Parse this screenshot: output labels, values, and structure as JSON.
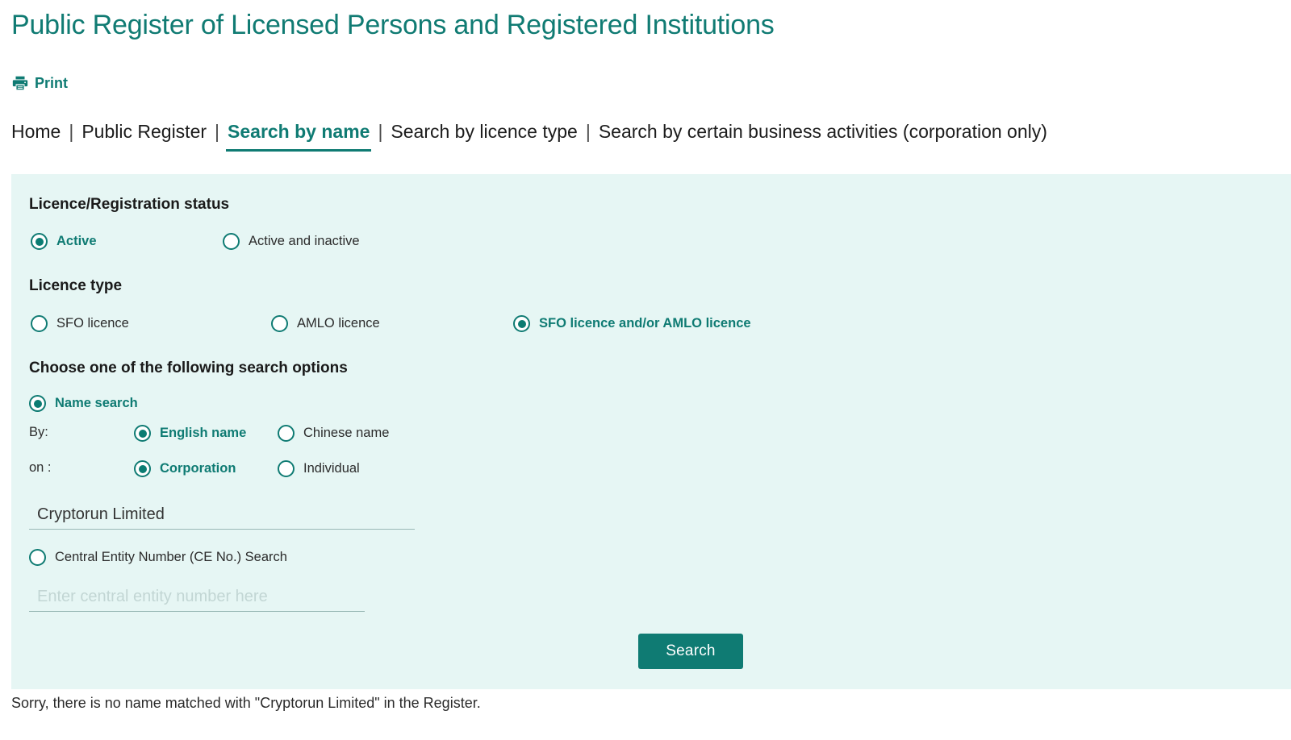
{
  "header": {
    "title": "Public Register of Licensed Persons and Registered Institutions",
    "print_label": "Print",
    "print_icon": "printer-icon"
  },
  "nav": {
    "separator": "|",
    "items": [
      {
        "label": "Home",
        "active": false
      },
      {
        "label": "Public Register",
        "active": false
      },
      {
        "label": "Search by name",
        "active": true
      },
      {
        "label": "Search by licence type",
        "active": false
      },
      {
        "label": "Search by certain business activities (corporation only)",
        "active": false
      }
    ]
  },
  "form": {
    "status": {
      "heading": "Licence/Registration status",
      "options": [
        {
          "label": "Active",
          "selected": true
        },
        {
          "label": "Active and inactive",
          "selected": false
        }
      ]
    },
    "licence_type": {
      "heading": "Licence type",
      "options": [
        {
          "label": "SFO licence",
          "selected": false
        },
        {
          "label": "AMLO licence",
          "selected": false
        },
        {
          "label": "SFO licence and/or AMLO licence",
          "selected": true
        }
      ]
    },
    "search_options": {
      "heading": "Choose one of the following search options",
      "name_search": {
        "label": "Name search",
        "selected": true
      },
      "by_label": "By:",
      "by_options": [
        {
          "label": "English name",
          "selected": true
        },
        {
          "label": "Chinese name",
          "selected": false
        }
      ],
      "on_label": "on :",
      "on_options": [
        {
          "label": "Corporation",
          "selected": true
        },
        {
          "label": "Individual",
          "selected": false
        }
      ],
      "name_input_value": "Cryptorun Limited",
      "name_input_placeholder": "",
      "ce_search": {
        "label": "Central Entity Number (CE No.) Search",
        "selected": false
      },
      "ce_input_value": "",
      "ce_input_placeholder": "Enter central entity number here"
    },
    "submit_label": "Search"
  },
  "result": {
    "message": "Sorry, there is no name matched with \"Cryptorun Limited\" in the Register."
  },
  "colors": {
    "brand_teal": "#0f7b73",
    "panel_bg": "#e6f6f4",
    "text": "#2b2b2b"
  }
}
